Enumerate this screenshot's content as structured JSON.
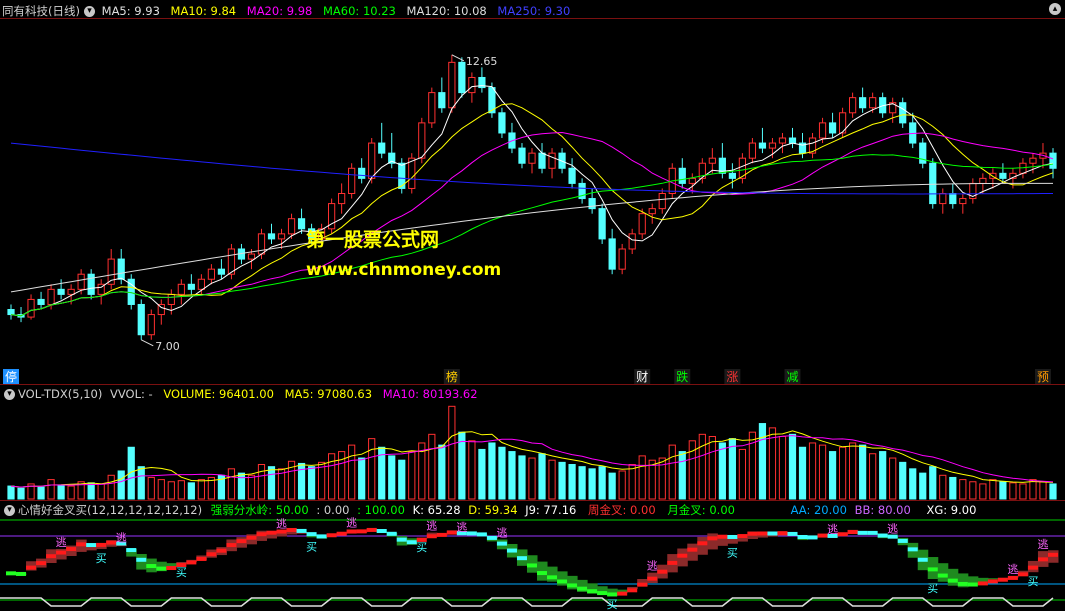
{
  "chart_data": {
    "type": "candlestick",
    "title": "同有科技(日线)",
    "price": {
      "ylim": [
        6.5,
        13.3
      ],
      "high_label": "12.65",
      "low_label": "7.00",
      "ma_values": {
        "MA5": "9.93",
        "MA10": "9.84",
        "MA20": "9.98",
        "MA60": "10.23",
        "MA120": "10.08",
        "MA250": "9.30"
      },
      "candles": [
        [
          7.6,
          7.7,
          7.4,
          7.5
        ],
        [
          7.5,
          7.65,
          7.35,
          7.45
        ],
        [
          7.45,
          7.9,
          7.4,
          7.8
        ],
        [
          7.8,
          7.95,
          7.6,
          7.7
        ],
        [
          7.7,
          8.1,
          7.6,
          8.0
        ],
        [
          8.0,
          8.2,
          7.8,
          7.9
        ],
        [
          7.9,
          8.1,
          7.7,
          8.0
        ],
        [
          8.0,
          8.4,
          7.9,
          8.3
        ],
        [
          8.3,
          8.4,
          7.8,
          7.9
        ],
        [
          7.9,
          8.2,
          7.7,
          8.1
        ],
        [
          8.1,
          8.8,
          8.0,
          8.6
        ],
        [
          8.6,
          8.8,
          8.1,
          8.2
        ],
        [
          8.2,
          8.3,
          7.6,
          7.7
        ],
        [
          7.7,
          7.8,
          7.0,
          7.1
        ],
        [
          7.1,
          7.6,
          7.0,
          7.5
        ],
        [
          7.5,
          7.8,
          7.3,
          7.7
        ],
        [
          7.7,
          8.0,
          7.5,
          7.9
        ],
        [
          7.9,
          8.2,
          7.7,
          8.1
        ],
        [
          8.1,
          8.3,
          7.9,
          8.0
        ],
        [
          8.0,
          8.3,
          7.9,
          8.2
        ],
        [
          8.2,
          8.5,
          8.1,
          8.4
        ],
        [
          8.4,
          8.6,
          8.2,
          8.3
        ],
        [
          8.3,
          8.9,
          8.2,
          8.8
        ],
        [
          8.8,
          8.9,
          8.5,
          8.6
        ],
        [
          8.6,
          8.8,
          8.4,
          8.7
        ],
        [
          8.7,
          9.2,
          8.6,
          9.1
        ],
        [
          9.1,
          9.3,
          8.9,
          9.0
        ],
        [
          9.0,
          9.2,
          8.8,
          9.1
        ],
        [
          9.1,
          9.5,
          9.0,
          9.4
        ],
        [
          9.4,
          9.6,
          9.1,
          9.2
        ],
        [
          9.2,
          9.3,
          8.9,
          9.0
        ],
        [
          9.0,
          9.3,
          8.9,
          9.2
        ],
        [
          9.2,
          9.8,
          9.1,
          9.7
        ],
        [
          9.7,
          10.1,
          9.5,
          9.9
        ],
        [
          9.9,
          10.5,
          9.8,
          10.4
        ],
        [
          10.4,
          10.6,
          10.1,
          10.2
        ],
        [
          10.2,
          11.0,
          10.1,
          10.9
        ],
        [
          10.9,
          11.3,
          10.6,
          10.7
        ],
        [
          10.7,
          11.1,
          10.4,
          10.5
        ],
        [
          10.5,
          10.6,
          9.9,
          10.0
        ],
        [
          10.0,
          10.7,
          9.9,
          10.6
        ],
        [
          10.6,
          11.4,
          10.5,
          11.3
        ],
        [
          11.3,
          12.0,
          11.2,
          11.9
        ],
        [
          11.9,
          12.2,
          11.5,
          11.6
        ],
        [
          11.6,
          12.65,
          11.5,
          12.5
        ],
        [
          12.5,
          12.6,
          11.8,
          11.9
        ],
        [
          11.9,
          12.3,
          11.7,
          12.2
        ],
        [
          12.2,
          12.4,
          11.9,
          12.0
        ],
        [
          12.0,
          12.1,
          11.4,
          11.5
        ],
        [
          11.5,
          11.6,
          11.0,
          11.1
        ],
        [
          11.1,
          11.3,
          10.7,
          10.8
        ],
        [
          10.8,
          10.9,
          10.4,
          10.5
        ],
        [
          10.5,
          10.8,
          10.3,
          10.7
        ],
        [
          10.7,
          10.9,
          10.3,
          10.4
        ],
        [
          10.4,
          10.8,
          10.2,
          10.7
        ],
        [
          10.7,
          10.8,
          10.3,
          10.4
        ],
        [
          10.4,
          10.6,
          10.0,
          10.1
        ],
        [
          10.1,
          10.2,
          9.7,
          9.8
        ],
        [
          9.8,
          10.0,
          9.5,
          9.6
        ],
        [
          9.6,
          9.7,
          8.9,
          9.0
        ],
        [
          9.0,
          9.2,
          8.3,
          8.4
        ],
        [
          8.4,
          8.9,
          8.3,
          8.8
        ],
        [
          8.8,
          9.2,
          8.7,
          9.1
        ],
        [
          9.1,
          9.6,
          9.0,
          9.5
        ],
        [
          9.5,
          9.7,
          9.3,
          9.6
        ],
        [
          9.6,
          10.0,
          9.5,
          9.9
        ],
        [
          9.9,
          10.5,
          9.8,
          10.4
        ],
        [
          10.4,
          10.6,
          10.0,
          10.1
        ],
        [
          10.1,
          10.3,
          9.9,
          10.2
        ],
        [
          10.2,
          10.6,
          10.1,
          10.5
        ],
        [
          10.5,
          10.8,
          10.3,
          10.6
        ],
        [
          10.6,
          10.9,
          10.2,
          10.3
        ],
        [
          10.3,
          10.5,
          10.0,
          10.2
        ],
        [
          10.2,
          10.7,
          10.1,
          10.6
        ],
        [
          10.6,
          11.0,
          10.5,
          10.9
        ],
        [
          10.9,
          11.2,
          10.7,
          10.8
        ],
        [
          10.8,
          11.0,
          10.6,
          10.9
        ],
        [
          10.9,
          11.1,
          10.7,
          11.0
        ],
        [
          11.0,
          11.2,
          10.8,
          10.9
        ],
        [
          10.9,
          11.1,
          10.6,
          10.7
        ],
        [
          10.7,
          11.1,
          10.6,
          11.0
        ],
        [
          11.0,
          11.4,
          10.9,
          11.3
        ],
        [
          11.3,
          11.5,
          11.0,
          11.1
        ],
        [
          11.1,
          11.6,
          11.0,
          11.5
        ],
        [
          11.5,
          11.9,
          11.4,
          11.8
        ],
        [
          11.8,
          12.0,
          11.5,
          11.6
        ],
        [
          11.6,
          11.9,
          11.5,
          11.8
        ],
        [
          11.8,
          11.9,
          11.4,
          11.5
        ],
        [
          11.5,
          11.8,
          11.3,
          11.7
        ],
        [
          11.7,
          11.8,
          11.2,
          11.3
        ],
        [
          11.3,
          11.5,
          10.8,
          10.9
        ],
        [
          10.9,
          11.0,
          10.4,
          10.5
        ],
        [
          10.5,
          10.6,
          9.6,
          9.7
        ],
        [
          9.7,
          10.0,
          9.5,
          9.9
        ],
        [
          9.9,
          10.1,
          9.6,
          9.7
        ],
        [
          9.7,
          9.9,
          9.5,
          9.8
        ],
        [
          9.8,
          10.2,
          9.7,
          10.1
        ],
        [
          10.1,
          10.3,
          9.9,
          10.2
        ],
        [
          10.2,
          10.4,
          10.0,
          10.3
        ],
        [
          10.3,
          10.5,
          10.1,
          10.2
        ],
        [
          10.2,
          10.4,
          10.0,
          10.3
        ],
        [
          10.3,
          10.6,
          10.2,
          10.5
        ],
        [
          10.5,
          10.7,
          10.3,
          10.6
        ],
        [
          10.6,
          10.9,
          10.4,
          10.7
        ],
        [
          10.7,
          10.8,
          10.2,
          10.4
        ]
      ]
    },
    "volume": {
      "title": "VOL-TDX(5,10)",
      "labels": [
        "VVOL: -",
        "VOLUME: 96401.00",
        "MA5: 97080.63",
        "MA10: 80193.62"
      ],
      "values": [
        12,
        10,
        14,
        11,
        18,
        13,
        12,
        16,
        15,
        14,
        22,
        26,
        48,
        30,
        20,
        18,
        16,
        17,
        15,
        18,
        20,
        22,
        28,
        24,
        22,
        32,
        30,
        28,
        35,
        33,
        30,
        34,
        42,
        44,
        50,
        38,
        56,
        48,
        40,
        36,
        44,
        52,
        60,
        50,
        86,
        62,
        54,
        46,
        52,
        48,
        44,
        40,
        38,
        42,
        36,
        34,
        32,
        30,
        28,
        30,
        24,
        26,
        32,
        40,
        36,
        38,
        50,
        44,
        54,
        60,
        58,
        52,
        56,
        46,
        62,
        70,
        66,
        58,
        60,
        48,
        52,
        50,
        44,
        48,
        52,
        50,
        42,
        44,
        38,
        34,
        28,
        24,
        30,
        22,
        20,
        18,
        16,
        14,
        18,
        16,
        15,
        14,
        18,
        16,
        14
      ],
      "ylim": [
        0,
        90
      ]
    },
    "indicator": {
      "title": "心情好金叉买(12,12,12,12,12,12)",
      "labels": [
        "强弱分水岭: 50.00",
        ": 0.00",
        ": 100.00",
        "K: 65.28",
        "D: 59.34",
        "J9: 77.16",
        "周金叉: 0.00",
        "月金叉: 0.00",
        "AA: 20.00",
        "BB: 80.00",
        "XG: 9.00"
      ]
    },
    "signals": [
      {
        "text": "停",
        "color": "#ffffff",
        "bg": "#1e90ff",
        "bar": 0
      },
      {
        "text": "榜",
        "color": "#ffcc00",
        "bg": "#1a1a1a",
        "bar": 44
      },
      {
        "text": "财",
        "color": "#ffffff",
        "bg": "#1a1a1a",
        "bar": 63
      },
      {
        "text": "跌",
        "color": "#00ff00",
        "bg": "#1a1a1a",
        "bar": 67
      },
      {
        "text": "涨",
        "color": "#ff3333",
        "bg": "#1a1a1a",
        "bar": 72
      },
      {
        "text": "减",
        "color": "#00ff00",
        "bg": "#1a1a1a",
        "bar": 78
      },
      {
        "text": "预",
        "color": "#ff9900",
        "bg": "#1a1a1a",
        "bar": 103
      }
    ],
    "indicator_marks": {
      "sell": [
        {
          "text": "逃",
          "bar": 5
        },
        {
          "text": "逃",
          "bar": 11
        },
        {
          "text": "逃",
          "bar": 27
        },
        {
          "text": "逃",
          "bar": 34
        },
        {
          "text": "逃",
          "bar": 42
        },
        {
          "text": "逃",
          "bar": 45
        },
        {
          "text": "逃",
          "bar": 49
        },
        {
          "text": "逃",
          "bar": 64
        },
        {
          "text": "逃",
          "bar": 82
        },
        {
          "text": "逃",
          "bar": 88
        },
        {
          "text": "逃",
          "bar": 100
        },
        {
          "text": "逃",
          "bar": 103
        }
      ],
      "buy": [
        {
          "text": "买",
          "bar": 9
        },
        {
          "text": "买",
          "bar": 17
        },
        {
          "text": "买",
          "bar": 30
        },
        {
          "text": "买",
          "bar": 41
        },
        {
          "text": "买",
          "bar": 60
        },
        {
          "text": "买",
          "bar": 72
        },
        {
          "text": "买",
          "bar": 92
        },
        {
          "text": "买",
          "bar": 102
        },
        {
          "text": "买",
          "bar": 116
        }
      ]
    }
  },
  "watermark": {
    "line1": "第一股票公式网",
    "line2": "www.chnmoney.com"
  },
  "colors": {
    "up": "#ff3030",
    "down": "#54ffff",
    "ma5": "#ffffff",
    "ma10": "#ffff00",
    "ma20": "#ff00ff",
    "ma60": "#00ff00",
    "ma120": "#dddddd",
    "ma250": "#2020ff"
  }
}
